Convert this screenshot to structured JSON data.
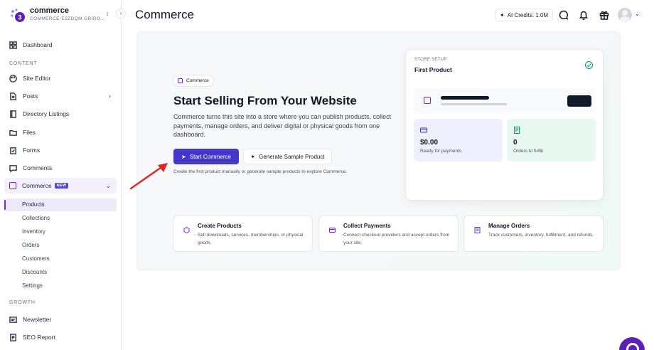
{
  "brand": {
    "name": "commerce",
    "subtitle": "COMMERCE-E2ZDQM.GRIDO..."
  },
  "sidebar": {
    "dashboard": "Dashboard",
    "content_label": "CONTENT",
    "site_editor": "Site Editor",
    "posts": "Posts",
    "directory": "Directory Listings",
    "files": "Files",
    "forms": "Forms",
    "comments": "Comments",
    "commerce": "Commerce",
    "commerce_badge": "NEW",
    "sub_items": [
      "Products",
      "Collections",
      "Inventory",
      "Orders",
      "Customers",
      "Discounts",
      "Settings"
    ],
    "growth_label": "GROWTH",
    "newsletter": "Newsletter",
    "seo_report": "SEO Report"
  },
  "header": {
    "title": "Commerce",
    "credits": "AI Credits: 1.0M"
  },
  "hero": {
    "pill": "Commerce",
    "title": "Start Selling From Your Website",
    "description": "Commerce turns this site into a store where you can publish products, collect payments, manage orders, and deliver digital or physical goods from one dashboard.",
    "primary_button": "Start Commerce",
    "secondary_button": "Generate Sample Product",
    "hint": "Create the first product manually or generate sample products to explore Commerce."
  },
  "setup_card": {
    "label": "STORE SETUP",
    "title": "First Product",
    "stat_revenue_value": "$0.00",
    "stat_revenue_label": "Ready for payments",
    "stat_orders_value": "0",
    "stat_orders_label": "Orders to fulfill"
  },
  "features": [
    {
      "title": "Create Products",
      "description": "Sell downloads, services, memberships, or physical goods."
    },
    {
      "title": "Collect Payments",
      "description": "Connect checkout providers and accept orders from your site."
    },
    {
      "title": "Manage Orders",
      "description": "Track customers, inventory, fulfillment, and refunds."
    }
  ],
  "colors": {
    "accent": "#4338ca",
    "brand_purple": "#6d28d9",
    "success": "#059669",
    "annotation_arrow": "#e02424"
  }
}
